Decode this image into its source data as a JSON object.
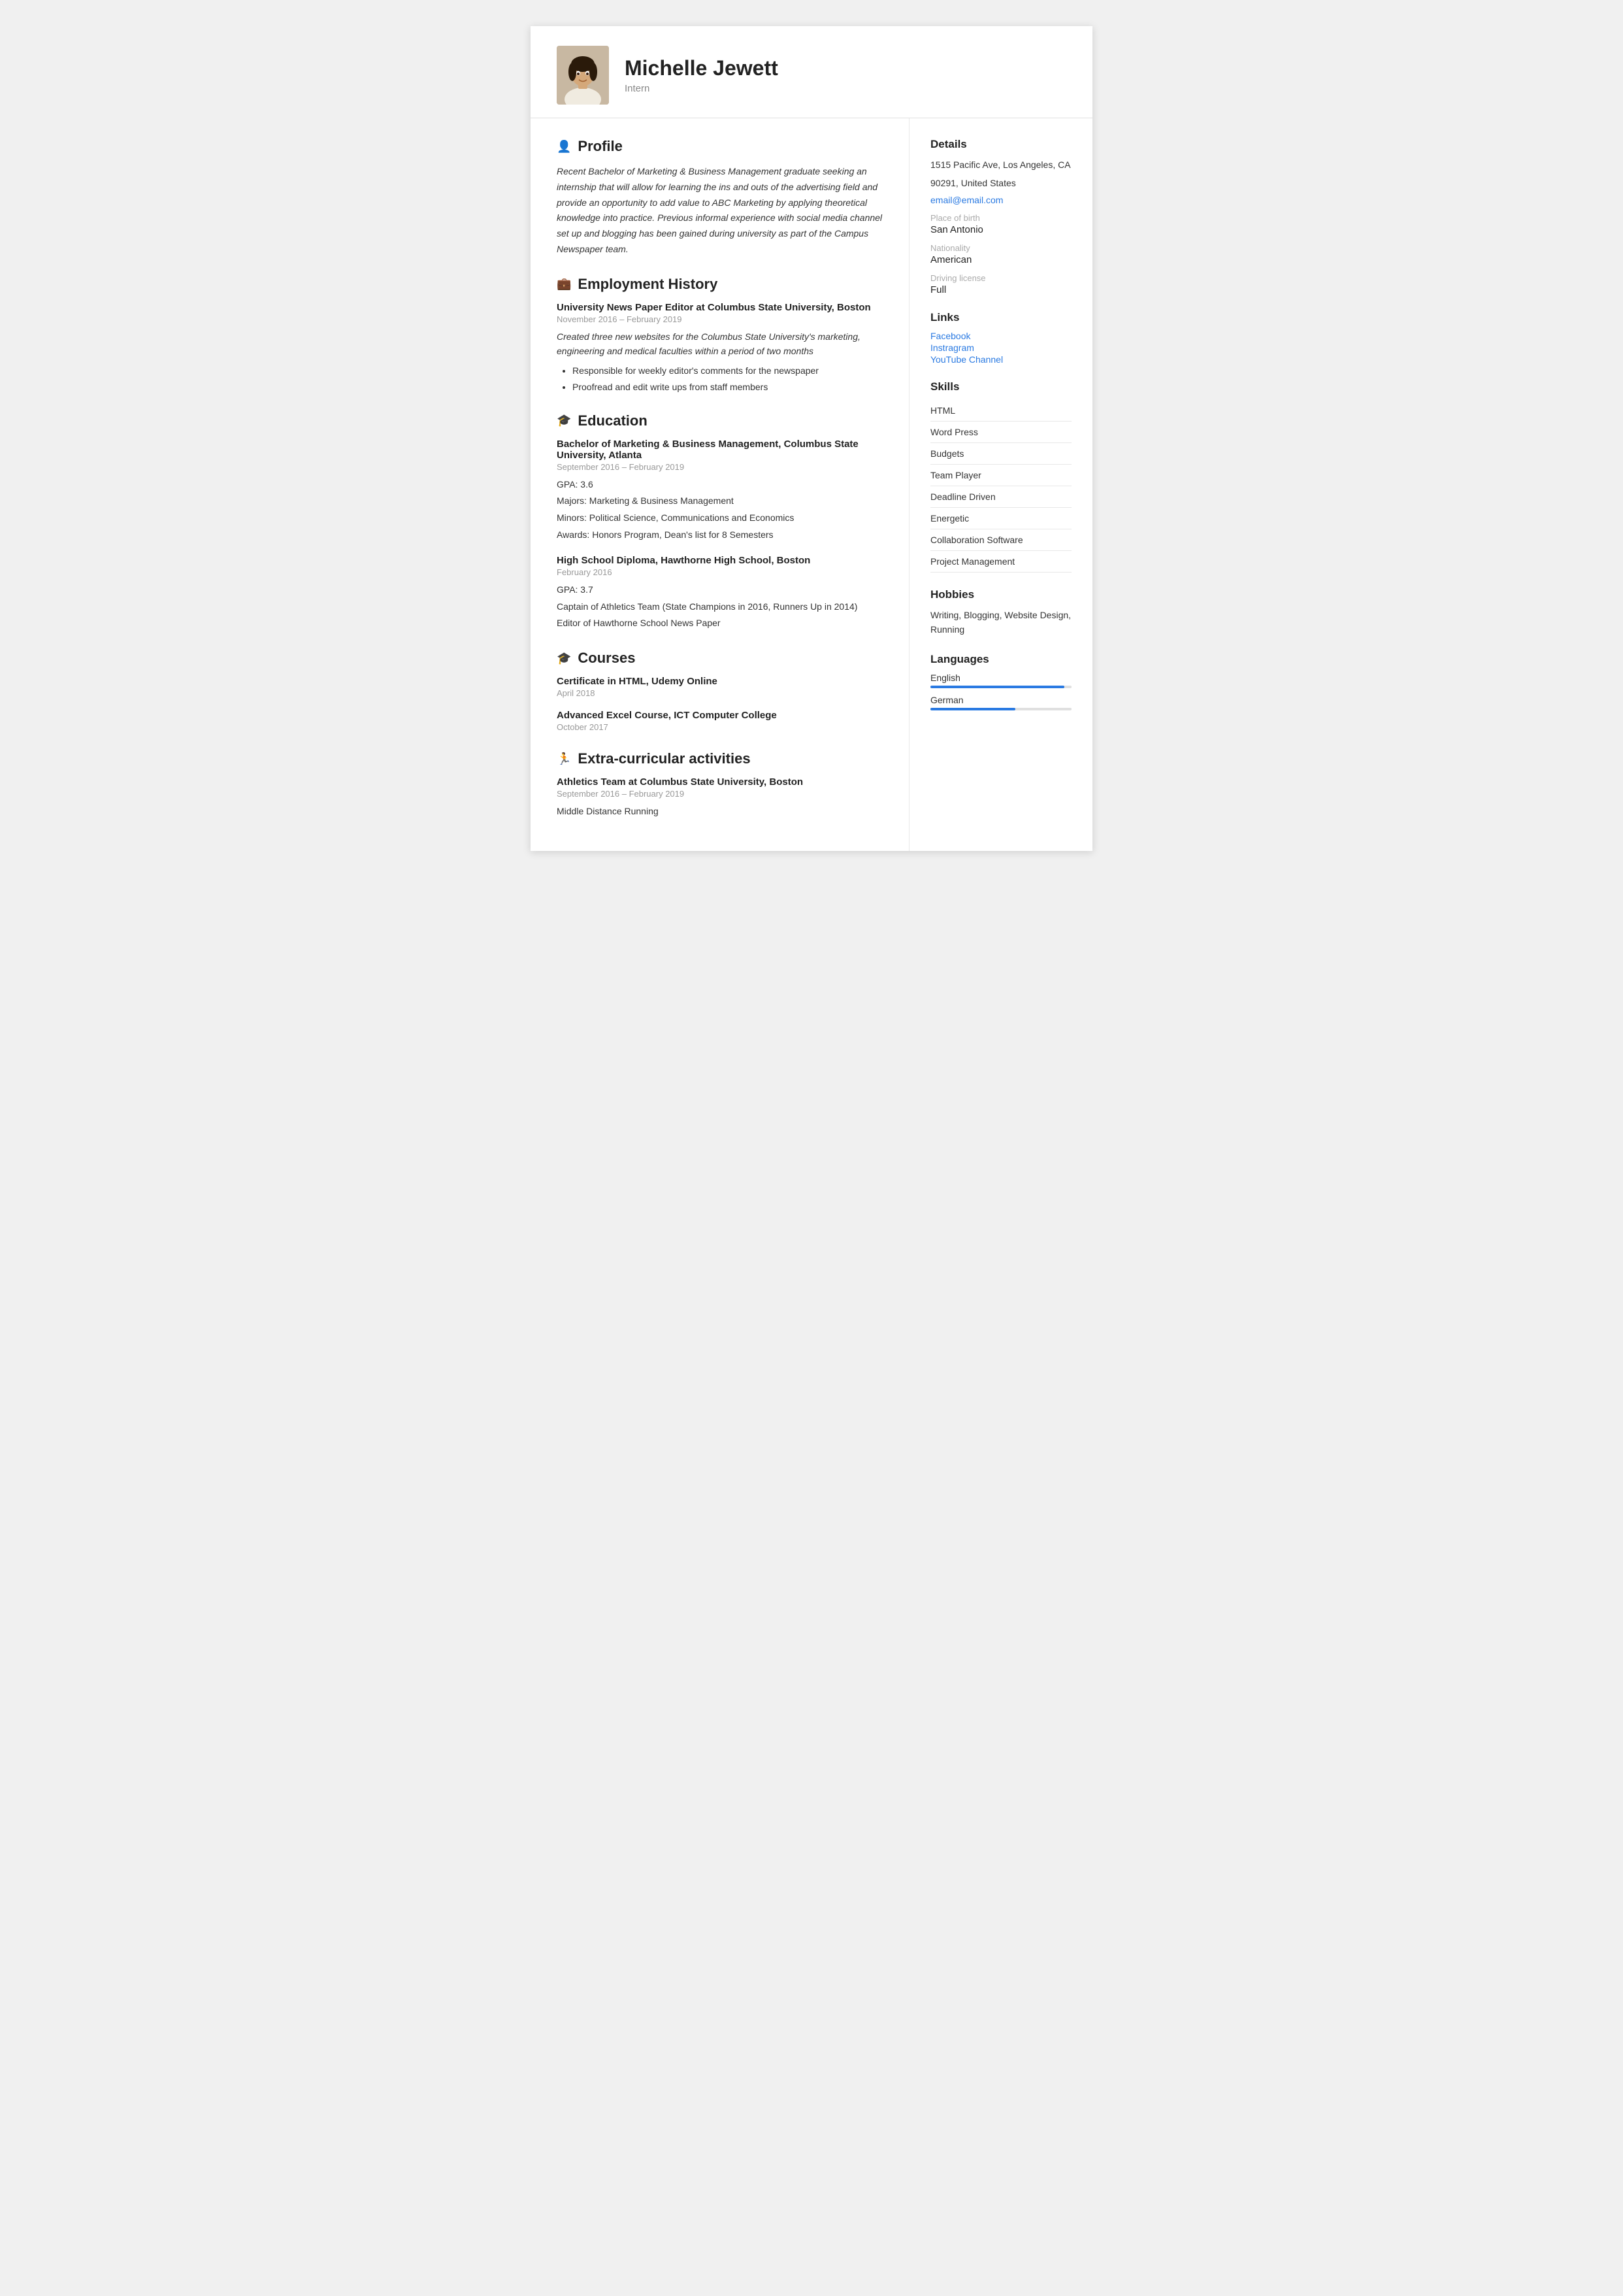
{
  "header": {
    "name": "Michelle Jewett",
    "title": "Intern"
  },
  "profile": {
    "section_label": "Profile",
    "text": "Recent Bachelor of Marketing & Business Management graduate seeking an internship that will allow for learning the ins and outs of the advertising field and provide an opportunity to add value to ABC Marketing by applying theoretical knowledge into practice. Previous informal experience with social media channel set up and blogging has been gained during university as part of the Campus Newspaper team."
  },
  "employment": {
    "section_label": "Employment History",
    "jobs": [
      {
        "title": "University News Paper Editor at Columbus State University, Boston",
        "dates": "November 2016 – February 2019",
        "description": "Created three new websites for the Columbus State University's marketing, engineering and medical faculties within a period of two months",
        "bullets": [
          "Responsible for weekly editor's comments for the newspaper",
          "Proofread and edit write ups from staff members"
        ]
      }
    ]
  },
  "education": {
    "section_label": "Education",
    "entries": [
      {
        "title": "Bachelor of Marketing & Business Management, Columbus State University, Atlanta",
        "dates": "September 2016 – February 2019",
        "details": [
          "GPA: 3.6",
          "Majors: Marketing & Business Management",
          "Minors: Political Science, Communications and Economics",
          "Awards: Honors Program, Dean's list for 8 Semesters"
        ]
      },
      {
        "title": "High School Diploma, Hawthorne High School, Boston",
        "dates": "February 2016",
        "details": [
          "GPA: 3.7",
          "Captain of Athletics Team (State Champions in 2016, Runners Up in 2014)",
          "Editor of Hawthorne School News Paper"
        ]
      }
    ]
  },
  "courses": {
    "section_label": "Courses",
    "entries": [
      {
        "title": "Certificate in HTML, Udemy Online",
        "dates": "April 2018"
      },
      {
        "title": "Advanced Excel Course, ICT Computer College",
        "dates": "October 2017"
      }
    ]
  },
  "extracurricular": {
    "section_label": "Extra-curricular activities",
    "entries": [
      {
        "title": "Athletics Team at Columbus State University, Boston",
        "dates": "September 2016 – February 2019",
        "details": [
          "Middle Distance Running"
        ]
      }
    ]
  },
  "details": {
    "section_label": "Details",
    "address_line1": "1515 Pacific Ave, Los Angeles, CA",
    "address_line2": "90291, United States",
    "email": "email@email.com",
    "place_of_birth_label": "Place of birth",
    "place_of_birth": "San Antonio",
    "nationality_label": "Nationality",
    "nationality": "American",
    "driving_license_label": "Driving license",
    "driving_license": "Full"
  },
  "links": {
    "section_label": "Links",
    "items": [
      {
        "label": "Facebook",
        "url": "#"
      },
      {
        "label": "Instragram",
        "url": "#"
      },
      {
        "label": "YouTube Channel",
        "url": "#"
      }
    ]
  },
  "skills": {
    "section_label": "Skills",
    "items": [
      "HTML",
      "Word Press",
      "Budgets",
      "Team Player",
      "Deadline Driven",
      "Energetic",
      "Collaboration Software",
      "Project Management"
    ]
  },
  "hobbies": {
    "section_label": "Hobbies",
    "text": "Writing, Blogging, Website Design, Running"
  },
  "languages": {
    "section_label": "Languages",
    "items": [
      {
        "name": "English",
        "level": 95
      },
      {
        "name": "German",
        "level": 60
      }
    ]
  }
}
